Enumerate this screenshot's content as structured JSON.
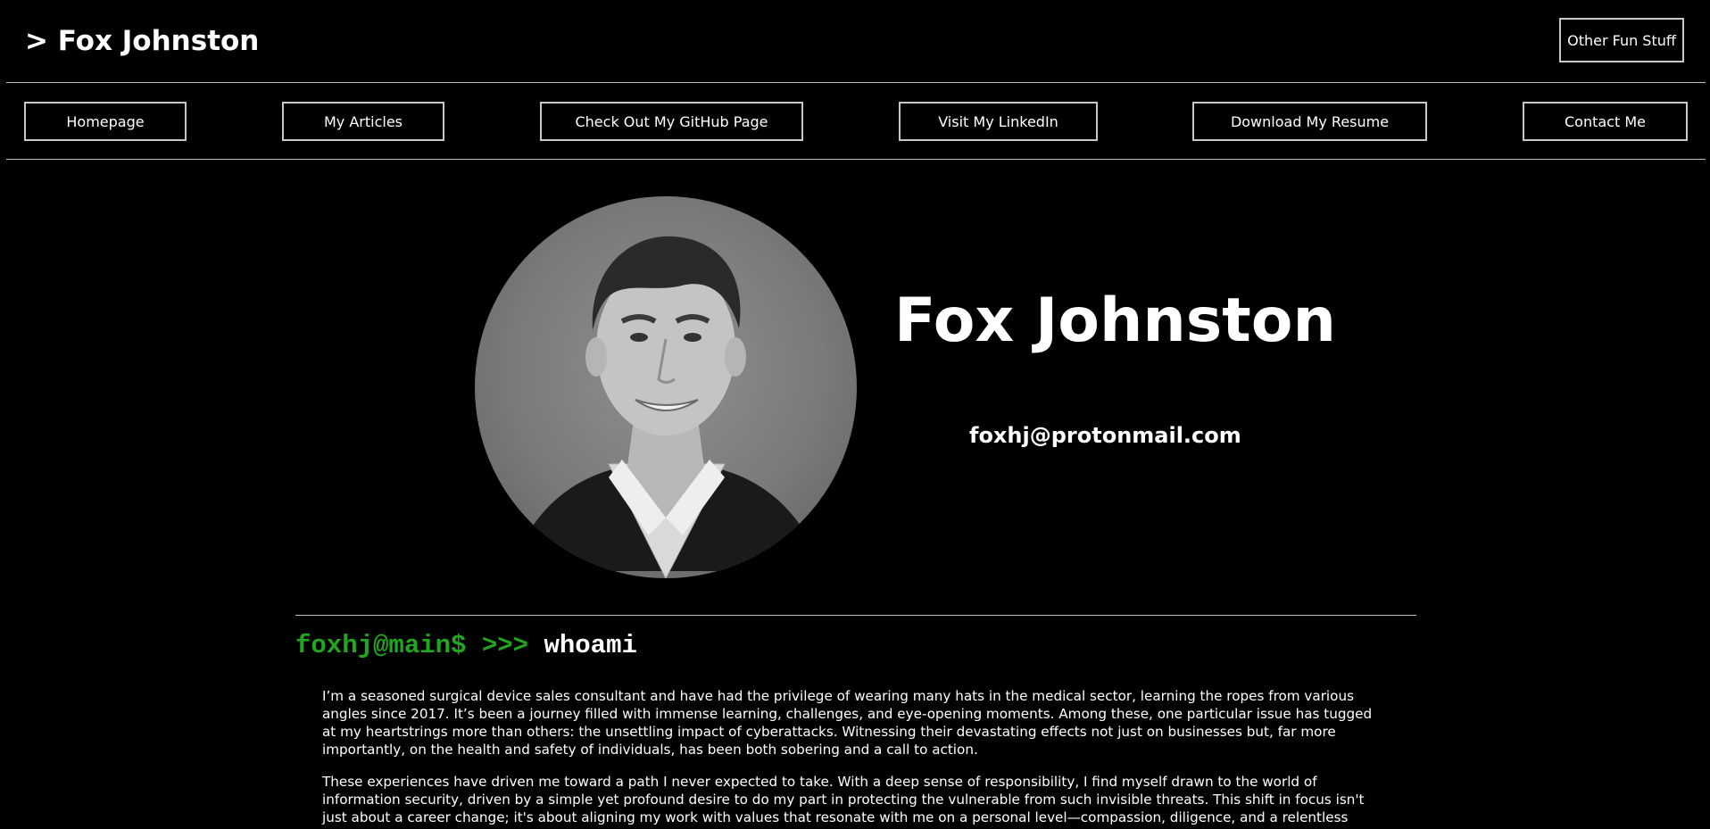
{
  "header": {
    "site_title": "> Fox Johnston",
    "other_button": "Other Fun Stuff"
  },
  "nav": {
    "items": [
      {
        "label": "Homepage"
      },
      {
        "label": "My Articles"
      },
      {
        "label": "Check Out My GitHub Page"
      },
      {
        "label": "Visit My LinkedIn"
      },
      {
        "label": "Download My Resume"
      },
      {
        "label": "Contact Me"
      }
    ]
  },
  "profile": {
    "name": "Fox Johnston",
    "email": "foxhj@protonmail.com",
    "photo_icon": "profile-photo"
  },
  "about": {
    "prompt_user": "foxhj@main$ >>> ",
    "prompt_command": "whoami",
    "paragraphs": [
      "I’m a seasoned surgical device sales consultant and have had the privilege of wearing many hats in the medical sector, learning the ropes from various angles since 2017. It’s been a journey filled with immense learning, challenges, and eye-opening moments. Among these, one particular issue has tugged at my heartstrings more than others: the unsettling impact of cyberattacks. Witnessing their devastating effects not just on businesses but, far more importantly, on the health and safety of individuals, has been both sobering and a call to action.",
      "These experiences have driven me toward a path I never expected to take. With a deep sense of responsibility, I find myself drawn to the world of information security, driven by a simple yet profound desire to do my part in protecting the vulnerable from such invisible threats. This shift in focus isn't just about a career change; it's about aligning my work with values that resonate with me on a personal level—compassion, diligence, and a relentless pursuit of making a tangible difference."
    ]
  },
  "colors": {
    "background": "#000000",
    "text": "#ffffff",
    "prompt_green": "#1fa81f",
    "border": "#c8c8c8"
  }
}
